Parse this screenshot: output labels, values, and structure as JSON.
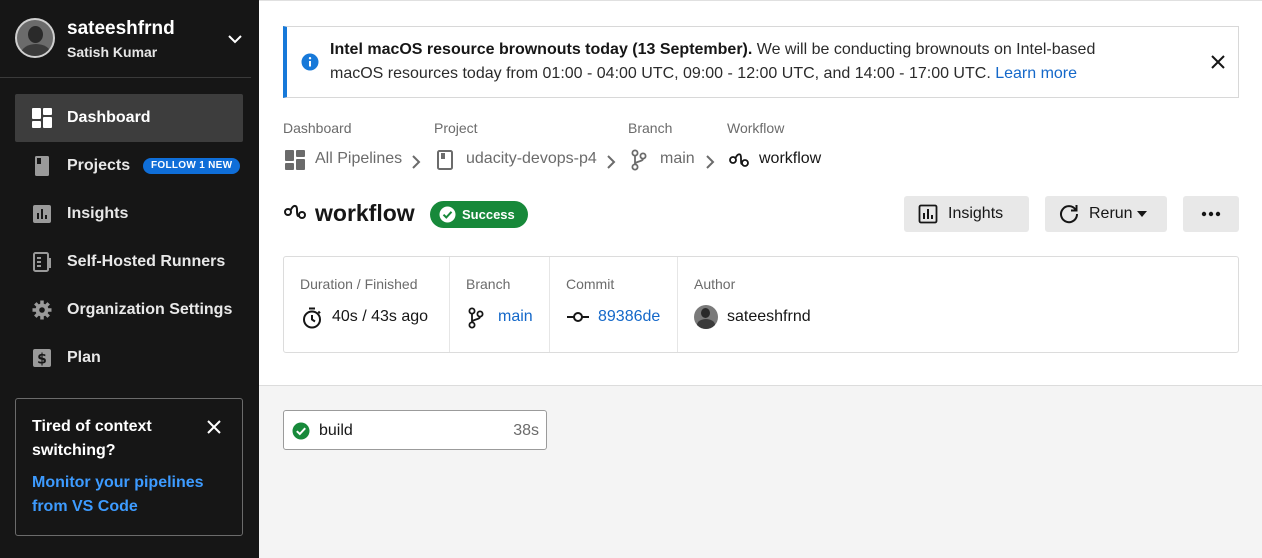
{
  "user": {
    "username": "sateeshfrnd",
    "full_name": "Satish Kumar"
  },
  "sidebar": {
    "items": [
      {
        "label": "Dashboard",
        "icon": "dashboard-icon",
        "active": true
      },
      {
        "label": "Projects",
        "icon": "project-icon",
        "badge": "FOLLOW 1 NEW"
      },
      {
        "label": "Insights",
        "icon": "insights-icon"
      },
      {
        "label": "Self-Hosted Runners",
        "icon": "runners-icon"
      },
      {
        "label": "Organization Settings",
        "icon": "gear-icon"
      },
      {
        "label": "Plan",
        "icon": "dollar-icon"
      }
    ],
    "promo": {
      "title": "Tired of context switching?",
      "link": "Monitor your pipelines from VS Code"
    }
  },
  "banner": {
    "bold": "Intel macOS resource brownouts today (13 September).",
    "text": " We will be conducting brownouts on Intel-based macOS resources today from 01:00 - 04:00 UTC, 09:00 - 12:00 UTC, and 14:00 - 17:00 UTC. ",
    "link": "Learn more"
  },
  "breadcrumb": {
    "dashboard": {
      "head": "Dashboard",
      "value": "All Pipelines"
    },
    "project": {
      "head": "Project",
      "value": "udacity-devops-p4"
    },
    "branch": {
      "head": "Branch",
      "value": "main"
    },
    "workflow": {
      "head": "Workflow",
      "value": "workflow"
    }
  },
  "workflow": {
    "title": "workflow",
    "status": "Success",
    "status_color": "#17893a"
  },
  "actions": {
    "insights": "Insights",
    "rerun": "Rerun",
    "more": "•••"
  },
  "details": {
    "duration": {
      "head": "Duration / Finished",
      "value": "40s / 43s ago"
    },
    "branch": {
      "head": "Branch",
      "value": "main"
    },
    "commit": {
      "head": "Commit",
      "value": "89386de"
    },
    "author": {
      "head": "Author",
      "value": "sateeshfrnd"
    }
  },
  "jobs": [
    {
      "name": "build",
      "duration": "38s",
      "status": "success"
    }
  ],
  "colors": {
    "accent": "#1468c9",
    "success": "#17893a",
    "sidebar_bg": "#161616"
  }
}
